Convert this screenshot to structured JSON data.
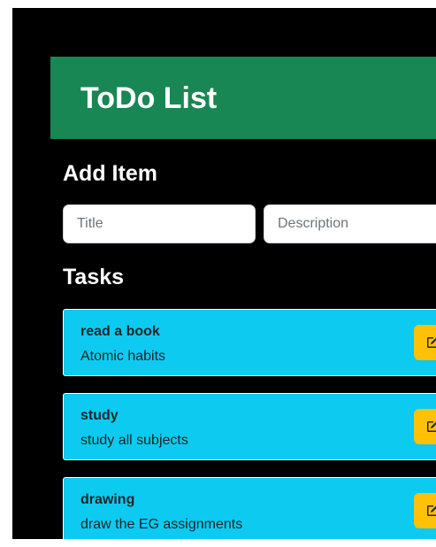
{
  "header": {
    "title": "ToDo List"
  },
  "add_item": {
    "heading": "Add Item",
    "title_input": {
      "placeholder": "Title",
      "value": ""
    },
    "description_input": {
      "placeholder": "Description",
      "value": ""
    }
  },
  "tasks": {
    "heading": "Tasks",
    "items": [
      {
        "title": "read a book",
        "description": "Atomic habits",
        "edit_icon": "edit-icon"
      },
      {
        "title": "study",
        "description": "study all subjects",
        "edit_icon": "edit-icon"
      },
      {
        "title": "drawing",
        "description": "draw the EG assignments",
        "edit_icon": "edit-icon"
      }
    ]
  },
  "colors": {
    "background": "#000000",
    "header": "#198754",
    "task_card": "#0dcaf0",
    "edit_button": "#ffc107"
  }
}
